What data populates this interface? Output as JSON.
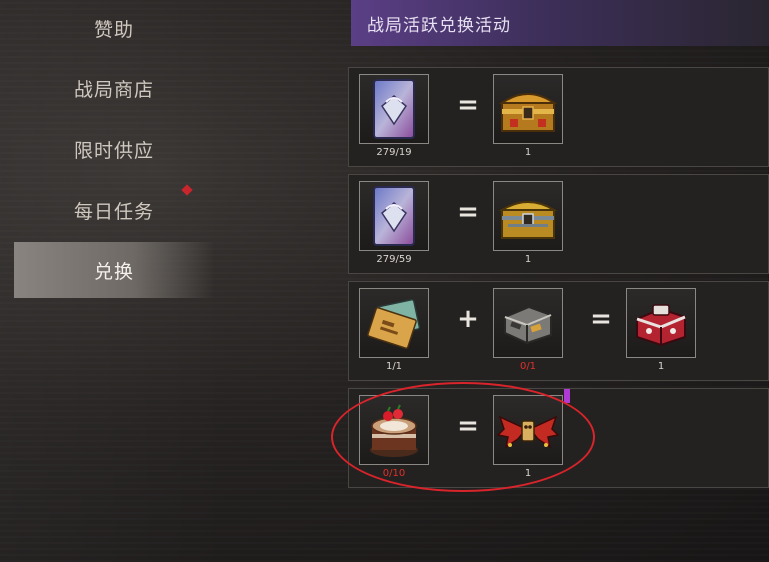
{
  "sidebar": {
    "items": [
      {
        "label": "赞助"
      },
      {
        "label": "战局商店"
      },
      {
        "label": "限时供应"
      },
      {
        "label": "每日任务"
      },
      {
        "label": "兑换"
      }
    ]
  },
  "header": {
    "title": "战局活跃兑换活动"
  },
  "rows": [
    {
      "input": {
        "icon": "card-icon",
        "count": "279/19"
      },
      "operator": "=",
      "output": {
        "icon": "treasure-chest-icon",
        "count": "1"
      }
    },
    {
      "input": {
        "icon": "card-icon",
        "count": "279/59"
      },
      "operator": "=",
      "output": {
        "icon": "treasure-chest-icon",
        "count": "1"
      }
    },
    {
      "input_a": {
        "icon": "envelope-icon",
        "count": "1/1"
      },
      "plus": "+",
      "input_b": {
        "icon": "metal-case-icon",
        "count": "0/1"
      },
      "operator": "=",
      "output": {
        "icon": "red-chest-icon",
        "count": "1"
      }
    },
    {
      "input": {
        "icon": "birthday-cake-icon",
        "count": "0/10"
      },
      "operator": "=",
      "output": {
        "icon": "devil-wings-icon",
        "count": "1"
      }
    }
  ],
  "colors": {
    "accent_purple": "#5b3f86",
    "warning_red": "#e0302c",
    "highlight_circle": "#d8242a"
  }
}
